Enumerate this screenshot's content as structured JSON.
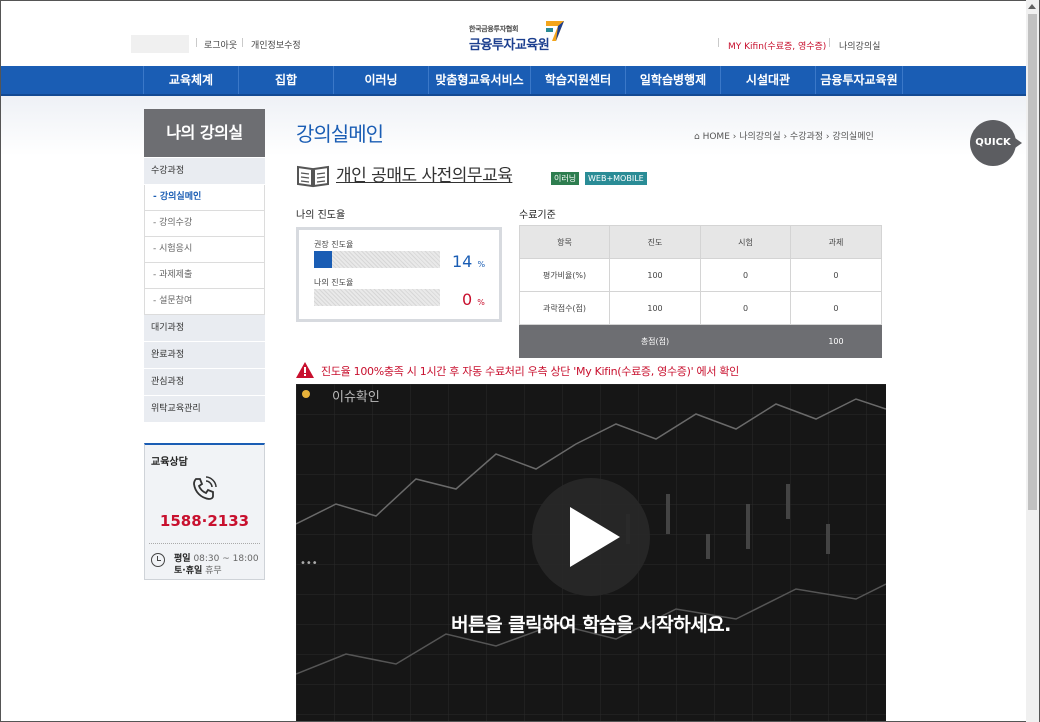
{
  "header": {
    "logout": "로그아웃",
    "edit_profile": "개인정보수정",
    "logo_sub": "한국금융투자협회",
    "logo_main": "금융투자교육원",
    "kifin": "MY Kifin(수료증, 영수증)",
    "my_room": "나의강의실"
  },
  "nav": [
    "교육체계",
    "집합",
    "이러닝",
    "맞춤형교육서비스",
    "학습지원센터",
    "일학습병행제",
    "시설대관",
    "금융투자교육원"
  ],
  "sidebar": {
    "title": "나의 강의실",
    "menu": [
      {
        "label": "수강과정"
      },
      {
        "label": "- 강의실메인"
      },
      {
        "label": "- 강의수강"
      },
      {
        "label": "- 시험응시"
      },
      {
        "label": "- 과제제출"
      },
      {
        "label": "- 설문참여"
      },
      {
        "label": "대기과정"
      },
      {
        "label": "완료과정"
      },
      {
        "label": "관심과정"
      },
      {
        "label": "위탁교육관리"
      }
    ],
    "consult": {
      "title": "교육상담",
      "phone": "1588·2133",
      "weekday_label": "평일",
      "weekday_hours": "08:30 ~ 18:00",
      "weekend_label": "토·휴일",
      "weekend_hours": "휴무"
    }
  },
  "main": {
    "page_title": "강의실메인",
    "breadcrumb": "⌂ HOME › 나의강의실 › 수강과정 › 강의실메인",
    "course_title": "개인 공매도 사전의무교육",
    "tag_type": "이러닝",
    "tag_platform": "WEB+MOBILE",
    "progress": {
      "heading": "나의 진도율",
      "recommended_label": "권장 진도율",
      "recommended_value": 14,
      "recommended_text": "14",
      "mine_label": "나의 진도율",
      "mine_value": 0,
      "mine_text": "0",
      "unit": "%"
    },
    "standard": {
      "heading": "수료기준",
      "headers": [
        "항목",
        "진도",
        "시험",
        "과제"
      ],
      "rows": [
        [
          "평가비율(%)",
          "100",
          "0",
          "0"
        ],
        [
          "과락점수(점)",
          "100",
          "0",
          "0"
        ]
      ],
      "total_label": "총점(점)",
      "total_value": "100"
    },
    "warning": "진도율 100%충족 시 1시간 후 자동 수료처리 우측 상단 'My Kifin(수료증, 영수증)' 에서 확인",
    "video": {
      "issue_label": "이슈확인",
      "start_message": "버튼을 클릭하여 학습을 시작하세요."
    },
    "quick": "QUICK"
  },
  "colors": {
    "brand_blue": "#1a5db4",
    "alert_red": "#c8102e",
    "sidebar_gray": "#6d6e72"
  }
}
